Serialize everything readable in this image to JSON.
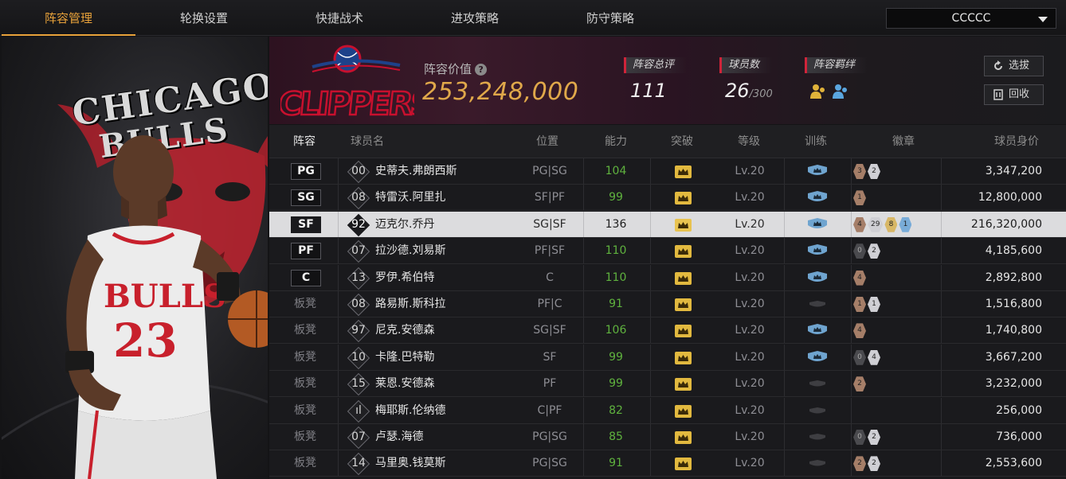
{
  "nav": {
    "tabs": [
      {
        "label": "阵容管理",
        "active": true
      },
      {
        "label": "轮换设置",
        "active": false
      },
      {
        "label": "快捷战术",
        "active": false
      },
      {
        "label": "进攻策略",
        "active": false
      },
      {
        "label": "防守策略",
        "active": false
      }
    ],
    "team_select": "CCCCC"
  },
  "art": {
    "wordmark_line1": "CHICAGO",
    "wordmark_line2": "BULLS"
  },
  "header": {
    "lineup_value_label": "阵容价值",
    "help_icon": "?",
    "lineup_value": "253,248,000",
    "overall_label": "阵容总评",
    "overall_value": "111",
    "players_label": "球员数",
    "players_value": "26",
    "players_max": "/300",
    "bond_label": "阵容羁绊",
    "select_button": "选拔",
    "recycle_button": "回收"
  },
  "table": {
    "headers": [
      "阵容",
      "球员名",
      "位置",
      "能力",
      "突破",
      "等级",
      "训练",
      "徽章",
      "球员身价"
    ],
    "rows": [
      {
        "slot": "PG",
        "bench": false,
        "num": "00",
        "name": "史蒂夫.弗朗西斯",
        "pos": "PG|SG",
        "ability": "104",
        "level": "Lv.20",
        "trained": true,
        "badges": [
          {
            "c": "bronze",
            "t": "3"
          },
          {
            "c": "silver",
            "t": "2"
          }
        ],
        "value": "3,347,200",
        "selected": false
      },
      {
        "slot": "SG",
        "bench": false,
        "num": "08",
        "name": "特雷沃.阿里扎",
        "pos": "SF|PF",
        "ability": "99",
        "level": "Lv.20",
        "trained": true,
        "badges": [
          {
            "c": "bronze",
            "t": "1"
          }
        ],
        "value": "12,800,000",
        "selected": false
      },
      {
        "slot": "SF",
        "bench": false,
        "num": "92",
        "name": "迈克尔.乔丹",
        "pos": "SG|SF",
        "ability": "136",
        "level": "Lv.20",
        "trained": true,
        "badges": [
          {
            "c": "bronze",
            "t": "4"
          },
          {
            "c": "silver",
            "t": "29"
          },
          {
            "c": "gold",
            "t": "8"
          },
          {
            "c": "blue",
            "t": "1"
          }
        ],
        "value": "216,320,000",
        "selected": true
      },
      {
        "slot": "PF",
        "bench": false,
        "num": "07",
        "name": "拉沙德.刘易斯",
        "pos": "PF|SF",
        "ability": "110",
        "level": "Lv.20",
        "trained": true,
        "badges": [
          {
            "c": "dark",
            "t": "0"
          },
          {
            "c": "silver",
            "t": "2"
          }
        ],
        "value": "4,185,600",
        "selected": false
      },
      {
        "slot": "C",
        "bench": false,
        "num": "13",
        "name": "罗伊.希伯特",
        "pos": "C",
        "ability": "110",
        "level": "Lv.20",
        "trained": true,
        "badges": [
          {
            "c": "bronze",
            "t": "4"
          }
        ],
        "value": "2,892,800",
        "selected": false
      },
      {
        "slot": "板凳",
        "bench": true,
        "num": "08",
        "name": "路易斯.斯科拉",
        "pos": "PF|C",
        "ability": "91",
        "level": "Lv.20",
        "trained": false,
        "badges": [
          {
            "c": "bronze",
            "t": "1"
          },
          {
            "c": "silver",
            "t": "1"
          }
        ],
        "value": "1,516,800",
        "selected": false
      },
      {
        "slot": "板凳",
        "bench": true,
        "num": "97",
        "name": "尼克.安德森",
        "pos": "SG|SF",
        "ability": "106",
        "level": "Lv.20",
        "trained": true,
        "badges": [
          {
            "c": "bronze",
            "t": "4"
          }
        ],
        "value": "1,740,800",
        "selected": false
      },
      {
        "slot": "板凳",
        "bench": true,
        "num": "10",
        "name": "卡隆.巴特勒",
        "pos": "SF",
        "ability": "99",
        "level": "Lv.20",
        "trained": true,
        "badges": [
          {
            "c": "dark",
            "t": "0"
          },
          {
            "c": "silver",
            "t": "4"
          }
        ],
        "value": "3,667,200",
        "selected": false
      },
      {
        "slot": "板凳",
        "bench": true,
        "num": "15",
        "name": "莱恩.安德森",
        "pos": "PF",
        "ability": "99",
        "level": "Lv.20",
        "trained": false,
        "badges": [
          {
            "c": "bronze",
            "t": "2"
          }
        ],
        "value": "3,232,000",
        "selected": false
      },
      {
        "slot": "板凳",
        "bench": true,
        "num": "ıl",
        "name": "梅耶斯.伦纳德",
        "pos": "C|PF",
        "ability": "82",
        "level": "Lv.20",
        "trained": false,
        "badges": [],
        "value": "256,000",
        "selected": false
      },
      {
        "slot": "板凳",
        "bench": true,
        "num": "07",
        "name": "卢瑟.海德",
        "pos": "PG|SG",
        "ability": "85",
        "level": "Lv.20",
        "trained": false,
        "badges": [
          {
            "c": "dark",
            "t": "0"
          },
          {
            "c": "silver",
            "t": "2"
          }
        ],
        "value": "736,000",
        "selected": false
      },
      {
        "slot": "板凳",
        "bench": true,
        "num": "14",
        "name": "马里奥.钱莫斯",
        "pos": "PG|SG",
        "ability": "91",
        "level": "Lv.20",
        "trained": false,
        "badges": [
          {
            "c": "bronze",
            "t": "2"
          },
          {
            "c": "silver",
            "t": "2"
          }
        ],
        "value": "2,553,600",
        "selected": false
      }
    ]
  },
  "colors": {
    "accent": "#e8a23a",
    "ability_green": "#5fb23e",
    "stat_marker_red": "#d0243a",
    "selected_row": "#dcdcde"
  }
}
